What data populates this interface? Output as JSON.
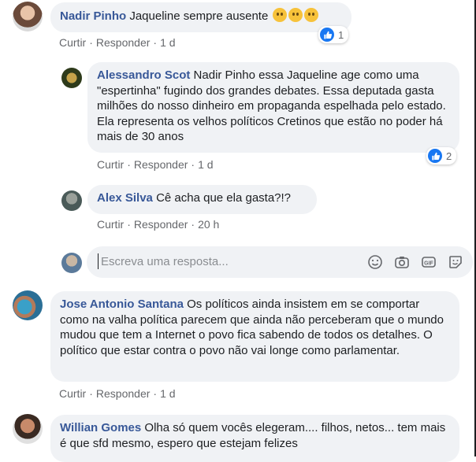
{
  "comments": [
    {
      "name": "Nadir Pinho",
      "text": "Jaqueline sempre ausente",
      "reactions": "1",
      "actions": {
        "like": "Curtir",
        "reply": "Responder",
        "time": "1 d"
      }
    },
    {
      "name": "Alessandro Scot",
      "text": "Nadir Pinho essa Jaqueline age como uma \"espertinha\" fugindo dos grandes debates. Essa deputada gasta milhões do nosso dinheiro em propaganda espelhada pelo estado. Ela representa os velhos políticos Cretinos que estão no poder há mais de 30 anos",
      "reactions": "2",
      "actions": {
        "like": "Curtir",
        "reply": "Responder",
        "time": "1 d"
      }
    },
    {
      "name": "Alex Silva",
      "text": "Cê acha que ela gasta?!?",
      "actions": {
        "like": "Curtir",
        "reply": "Responder",
        "time": "20 h"
      }
    },
    {
      "name": "Jose Antonio Santana",
      "text": "Os políticos ainda insistem em se comportar como na valha política parecem que ainda não perceberam que o mundo mudou que tem a Internet o povo fica sabendo de todos os detalhes. O político que estar contra o povo não vai longe como parlamentar.",
      "actions": {
        "like": "Curtir",
        "reply": "Responder",
        "time": "1 d"
      }
    },
    {
      "name": "Willian Gomes",
      "text": "Olha só quem vocês elegeram.... filhos, netos... tem mais é que sfd mesmo, espero que estejam felizes"
    }
  ],
  "reply": {
    "placeholder": "Escreva uma resposta..."
  },
  "colors": {
    "name": "#385898",
    "bubble": "#f0f2f5",
    "like": "#1877f2"
  },
  "icons": [
    "thumbs-up-icon",
    "thinking-face-icon",
    "smiley-icon",
    "camera-icon",
    "gif-icon",
    "sticker-icon"
  ]
}
